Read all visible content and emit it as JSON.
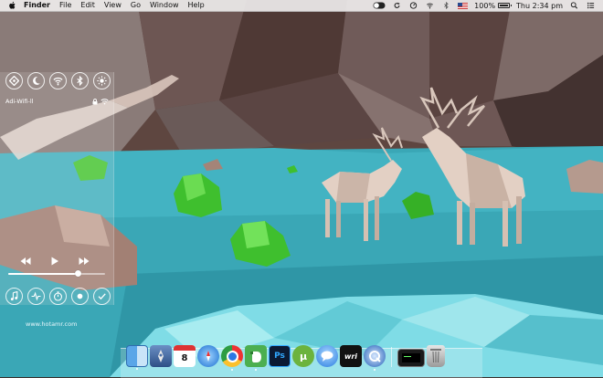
{
  "menubar": {
    "app_name": "Finder",
    "menus": [
      "File",
      "Edit",
      "View",
      "Go",
      "Window",
      "Help"
    ],
    "battery_percent": "100%",
    "battery_level": 1.0,
    "clock": "Thu 2:34 pm"
  },
  "panel": {
    "toggles": [
      "location-icon",
      "moon-icon",
      "wifi-icon",
      "bluetooth-icon",
      "brightness-icon"
    ],
    "wifi_network": "Adi-Wifi-ll",
    "media_controls": [
      "rewind-icon",
      "play-icon",
      "fast-forward-icon"
    ],
    "volume_level": 0.72,
    "bottom_buttons": [
      "music-note-icon",
      "activity-icon",
      "timer-icon",
      "record-icon",
      "checkmark-icon"
    ]
  },
  "watermark": "www.hotamr.com",
  "dock": {
    "apps": [
      {
        "name": "finder",
        "label": ""
      },
      {
        "name": "launchpad",
        "label": ""
      },
      {
        "name": "calendar",
        "label": "8"
      },
      {
        "name": "safari",
        "label": ""
      },
      {
        "name": "chrome",
        "label": ""
      },
      {
        "name": "evernote",
        "label": ""
      },
      {
        "name": "photoshop",
        "label": "Ps"
      },
      {
        "name": "utorrent",
        "label": "µ"
      },
      {
        "name": "messages",
        "label": ""
      },
      {
        "name": "writer",
        "label": "wri"
      },
      {
        "name": "quicktime",
        "label": ""
      }
    ]
  }
}
